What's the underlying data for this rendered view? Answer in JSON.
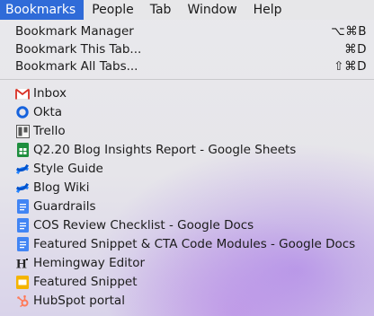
{
  "menubar": {
    "items": [
      {
        "label": "Bookmarks"
      },
      {
        "label": "People"
      },
      {
        "label": "Tab"
      },
      {
        "label": "Window"
      },
      {
        "label": "Help"
      }
    ]
  },
  "menu": {
    "commands": [
      {
        "label": "Bookmark Manager",
        "shortcut": "⌥⌘B"
      },
      {
        "label": "Bookmark This Tab...",
        "shortcut": "⌘D"
      },
      {
        "label": "Bookmark All Tabs...",
        "shortcut": "⇧⌘D"
      }
    ],
    "bookmarks": [
      {
        "label": "Inbox",
        "icon": "gmail-icon"
      },
      {
        "label": "Okta",
        "icon": "okta-icon"
      },
      {
        "label": "Trello",
        "icon": "trello-icon"
      },
      {
        "label": "Q2.20 Blog Insights Report - Google Sheets",
        "icon": "google-sheets-icon"
      },
      {
        "label": "Style Guide",
        "icon": "confluence-icon"
      },
      {
        "label": "Blog Wiki",
        "icon": "confluence-icon"
      },
      {
        "label": "Guardrails",
        "icon": "google-docs-icon"
      },
      {
        "label": "COS Review Checklist - Google Docs",
        "icon": "google-docs-icon"
      },
      {
        "label": "Featured Snippet & CTA Code Modules - Google Docs",
        "icon": "google-docs-icon"
      },
      {
        "label": "Hemingway Editor",
        "icon": "hemingway-icon"
      },
      {
        "label": "Featured Snippet",
        "icon": "google-slides-icon"
      },
      {
        "label": "HubSpot portal",
        "icon": "hubspot-icon"
      }
    ]
  },
  "colors": {
    "highlight": "#2f6bd8",
    "gmail": "#d93025",
    "okta": "#1662dd",
    "sheets": "#1e8e3e",
    "docs": "#4285f4",
    "slides": "#f4b400",
    "confluence": "#2684ff",
    "hubspot": "#ff7a59"
  }
}
